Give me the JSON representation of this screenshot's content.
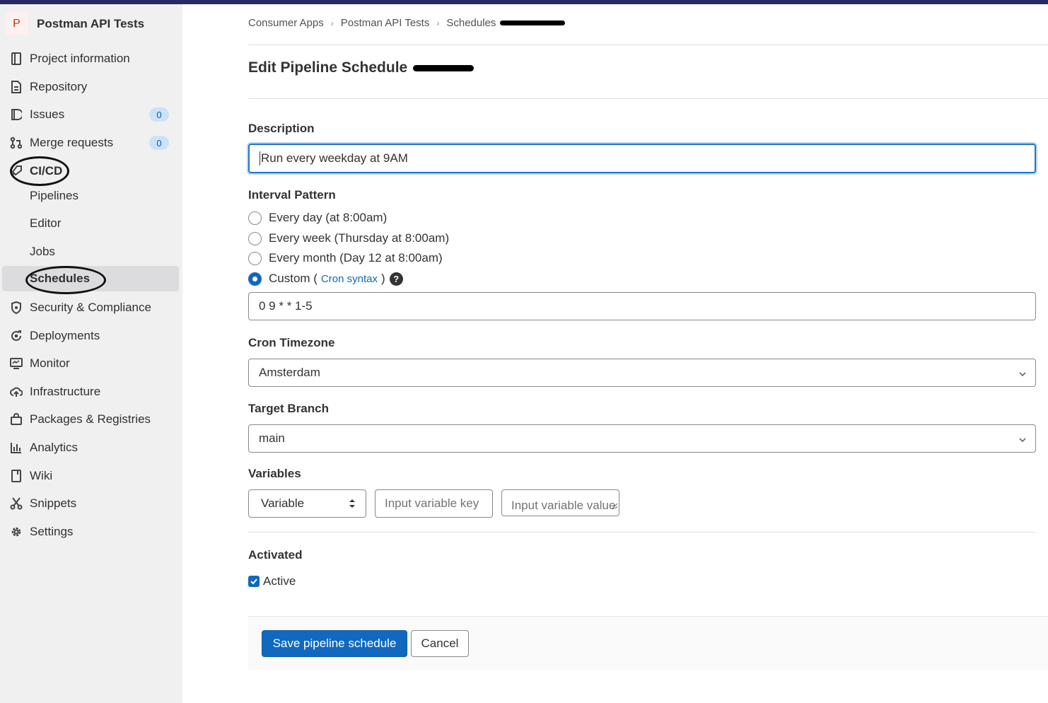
{
  "project": {
    "avatar_letter": "P",
    "name": "Postman API Tests"
  },
  "sidebar": {
    "items": [
      {
        "label": "Project information",
        "icon": "project-info-icon"
      },
      {
        "label": "Repository",
        "icon": "repository-icon"
      },
      {
        "label": "Issues",
        "icon": "issues-icon",
        "badge": "0"
      },
      {
        "label": "Merge requests",
        "icon": "merge-request-icon",
        "badge": "0"
      },
      {
        "label": "CI/CD",
        "icon": "rocket-icon"
      },
      {
        "label": "Security & Compliance",
        "icon": "shield-icon"
      },
      {
        "label": "Deployments",
        "icon": "deployments-icon"
      },
      {
        "label": "Monitor",
        "icon": "monitor-icon"
      },
      {
        "label": "Infrastructure",
        "icon": "cloud-icon"
      },
      {
        "label": "Packages & Registries",
        "icon": "package-icon"
      },
      {
        "label": "Analytics",
        "icon": "chart-icon"
      },
      {
        "label": "Wiki",
        "icon": "book-icon"
      },
      {
        "label": "Snippets",
        "icon": "scissors-icon"
      },
      {
        "label": "Settings",
        "icon": "gear-icon"
      }
    ],
    "cicd_sub": [
      "Pipelines",
      "Editor",
      "Jobs",
      "Schedules"
    ]
  },
  "breadcrumb": [
    "Consumer Apps",
    "Postman API Tests",
    "Schedules"
  ],
  "page_title": "Edit Pipeline Schedule",
  "form": {
    "description_label": "Description",
    "description_value": "Run every weekday at 9AM",
    "interval_label": "Interval Pattern",
    "options": [
      "Every day (at 8:00am)",
      "Every week (Thursday at 8:00am)",
      "Every month (Day 12 at 8:00am)"
    ],
    "custom_label": "Custom (",
    "custom_link": "Cron syntax",
    "custom_close": ")",
    "help_glyph": "?",
    "cron_value": "0 9 * * 1-5",
    "timezone_label": "Cron Timezone",
    "timezone_value": "Amsterdam",
    "branch_label": "Target Branch",
    "branch_value": "main",
    "variables_label": "Variables",
    "variable_type": "Variable",
    "variable_key_placeholder": "Input variable key",
    "variable_value_placeholder": "Input variable value",
    "activated_label": "Activated",
    "active_label": "Active",
    "active_checked": true
  },
  "buttons": {
    "save": "Save pipeline schedule",
    "cancel": "Cancel"
  },
  "colors": {
    "accent": "#1068bf",
    "topbar": "#292961",
    "sidebar_bg": "#f0f0f0"
  }
}
